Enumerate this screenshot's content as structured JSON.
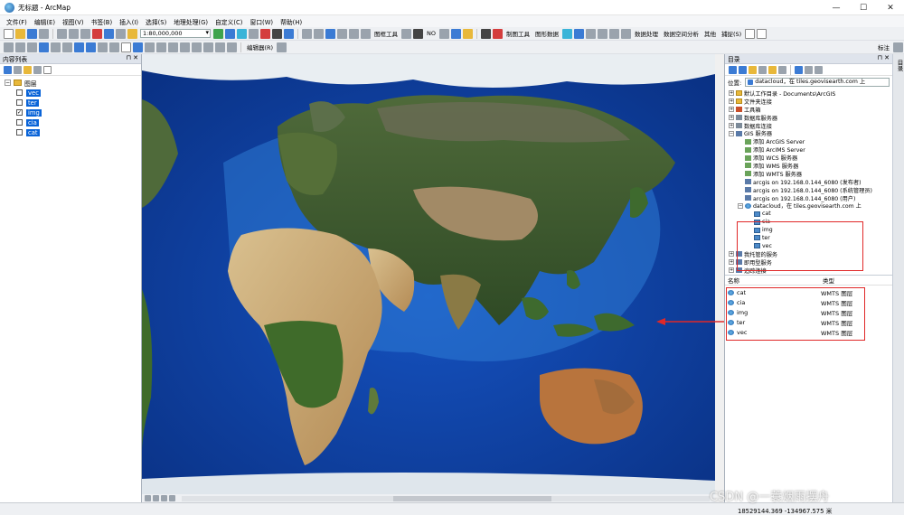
{
  "window": {
    "title": "无标题 - ArcMap",
    "controls": [
      "—",
      "☐",
      "✕"
    ]
  },
  "menubar": [
    "文件(F)",
    "编辑(E)",
    "视图(V)",
    "书签(B)",
    "插入(I)",
    "选择(S)",
    "地理处理(G)",
    "自定义(C)",
    "窗口(W)",
    "帮助(H)"
  ],
  "toolbar": {
    "scale": "1:80,000,000",
    "labels": [
      "图框工具",
      "NO",
      "制图工具",
      "图形数据",
      "数据处理",
      "数据空间分析",
      "其他",
      "捕捉(S)",
      "标注",
      "编辑器(R)"
    ]
  },
  "toc": {
    "title": "内容列表",
    "root": "图层",
    "layers": [
      {
        "name": "vec",
        "checked": false
      },
      {
        "name": "ter",
        "checked": false
      },
      {
        "name": "img",
        "checked": true
      },
      {
        "name": "cia",
        "checked": false
      },
      {
        "name": "cat",
        "checked": false
      }
    ]
  },
  "catalog": {
    "title": "目录",
    "location_label": "位置:",
    "location": "datacloud，在 tiles.geovisearth.com 上",
    "tree": [
      {
        "label": "默认工作目录 - Documents\\ArcGIS",
        "icon": "folder",
        "level": 0,
        "exp": "+"
      },
      {
        "label": "文件夹连接",
        "icon": "folder",
        "level": 0,
        "exp": "+"
      },
      {
        "label": "工具箱",
        "icon": "tool",
        "level": 0,
        "exp": "+"
      },
      {
        "label": "数据库服务器",
        "icon": "db",
        "level": 0,
        "exp": "+"
      },
      {
        "label": "数据库连接",
        "icon": "db",
        "level": 0,
        "exp": "+"
      },
      {
        "label": "GIS 服务器",
        "icon": "server",
        "level": 0,
        "exp": "−"
      },
      {
        "label": "添加 ArcGIS Server",
        "icon": "add",
        "level": 1,
        "exp": ""
      },
      {
        "label": "添加 ArcIMS Server",
        "icon": "add",
        "level": 1,
        "exp": ""
      },
      {
        "label": "添加 WCS 服务器",
        "icon": "add",
        "level": 1,
        "exp": ""
      },
      {
        "label": "添加 WMS 服务器",
        "icon": "add",
        "level": 1,
        "exp": ""
      },
      {
        "label": "添加 WMTS 服务器",
        "icon": "add",
        "level": 1,
        "exp": ""
      },
      {
        "label": "arcgis on 192.168.0.144_6080 (发布者)",
        "icon": "server",
        "level": 1,
        "exp": ""
      },
      {
        "label": "arcgis on 192.168.0.144_6080 (系统管理员)",
        "icon": "server",
        "level": 1,
        "exp": ""
      },
      {
        "label": "arcgis on 192.168.0.144_6080 (用户)",
        "icon": "server",
        "level": 1,
        "exp": ""
      },
      {
        "label": "datacloud，在 tiles.geovisearth.com 上",
        "icon": "globe",
        "level": 1,
        "exp": "−"
      },
      {
        "label": "cat",
        "icon": "layer",
        "level": 2,
        "exp": ""
      },
      {
        "label": "cia",
        "icon": "layer",
        "level": 2,
        "exp": ""
      },
      {
        "label": "img",
        "icon": "layer",
        "level": 2,
        "exp": ""
      },
      {
        "label": "ter",
        "icon": "layer",
        "level": 2,
        "exp": ""
      },
      {
        "label": "vec",
        "icon": "layer",
        "level": 2,
        "exp": ""
      },
      {
        "label": "我托管的服务",
        "icon": "server",
        "level": 0,
        "exp": "+"
      },
      {
        "label": "即用型服务",
        "icon": "server",
        "level": 0,
        "exp": "+"
      },
      {
        "label": "追踪连接",
        "icon": "server",
        "level": 0,
        "exp": "+"
      }
    ],
    "list_headers": [
      "名称",
      "类型"
    ],
    "list": [
      {
        "name": "cat",
        "type": "WMTS 图层"
      },
      {
        "name": "cia",
        "type": "WMTS 图层"
      },
      {
        "name": "img",
        "type": "WMTS 图层"
      },
      {
        "name": "ter",
        "type": "WMTS 图层"
      },
      {
        "name": "vec",
        "type": "WMTS 图层"
      }
    ]
  },
  "right_strip": "目录",
  "status": {
    "coords": "18529144.369  -134967.575 米"
  },
  "watermark": "CSDN @一蓑烟雨摆舟",
  "colors": {
    "accent_red": "#e02828",
    "selection": "#0a64d8",
    "ocean_deep": "#0d3f9c"
  }
}
